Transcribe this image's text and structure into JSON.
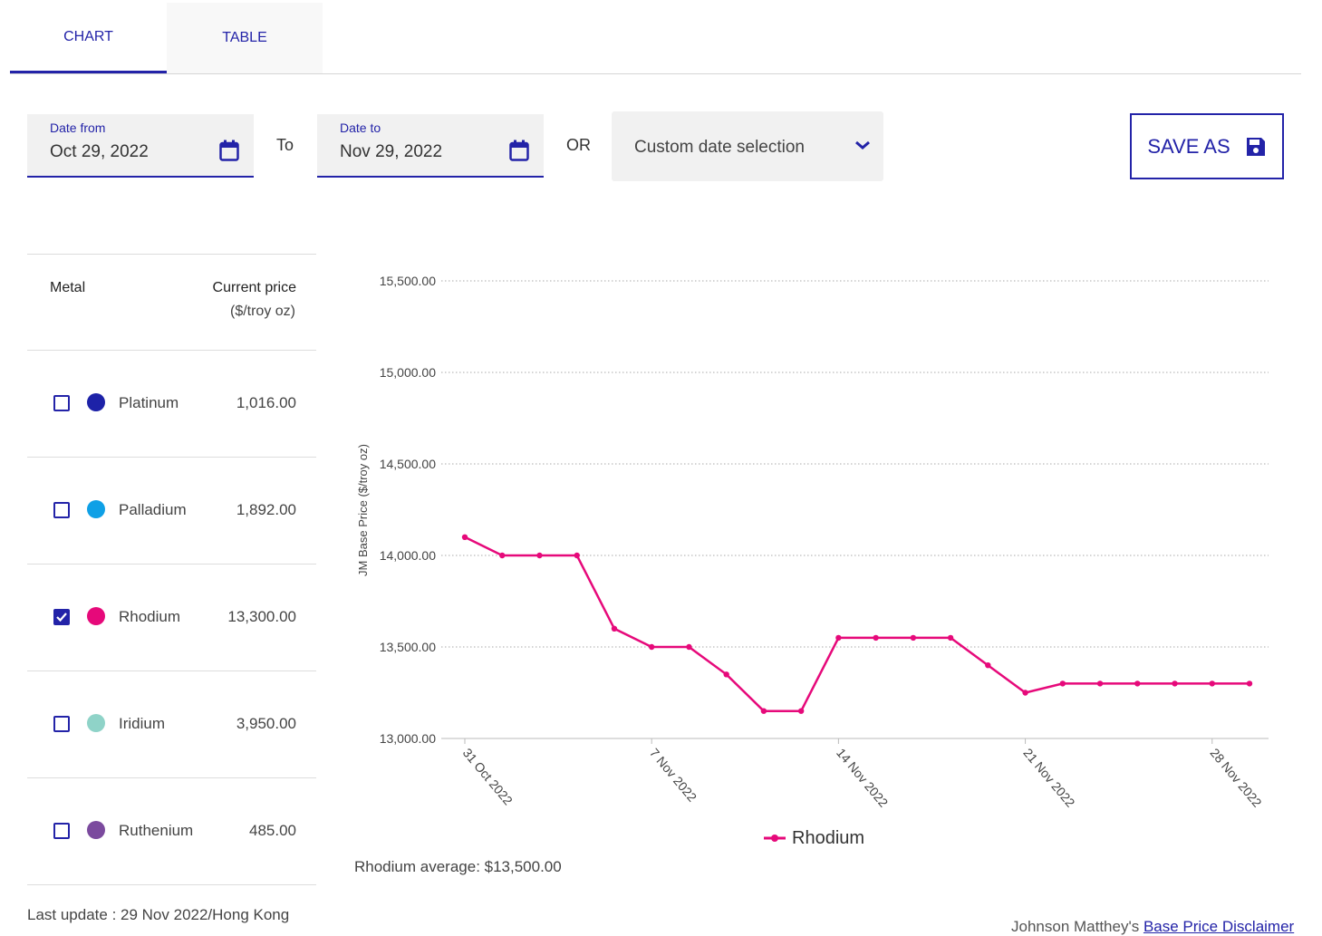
{
  "tabs": [
    {
      "label": "CHART",
      "active": true
    },
    {
      "label": "TABLE",
      "active": false
    }
  ],
  "date_from": {
    "label": "Date from",
    "value": "Oct 29, 2022"
  },
  "to_label": "To",
  "date_to": {
    "label": "Date to",
    "value": "Nov 29, 2022"
  },
  "or_label": "OR",
  "custom_select": {
    "value": "Custom date selection"
  },
  "save_as": {
    "label": "SAVE AS",
    "icon": "floppy-disk-icon"
  },
  "table": {
    "header_metal": "Metal",
    "header_price": "Current price",
    "header_unit": "($/troy oz)",
    "rows": [
      {
        "name": "Platinum",
        "price": "1,016.00",
        "color": "#1d22a8",
        "checked": false
      },
      {
        "name": "Palladium",
        "price": "1,892.00",
        "color": "#0fa0e6",
        "checked": false
      },
      {
        "name": "Rhodium",
        "price": "13,300.00",
        "color": "#e6097a",
        "checked": true
      },
      {
        "name": "Iridium",
        "price": "3,950.00",
        "color": "#8fd3c8",
        "checked": false
      },
      {
        "name": "Ruthenium",
        "price": "485.00",
        "color": "#7b4a9e",
        "checked": false
      }
    ]
  },
  "last_update": "Last update : 29 Nov 2022/Hong Kong",
  "average": "Rhodium average: $13,500.00",
  "disclaimer": {
    "prefix": "Johnson Matthey's ",
    "link": "Base Price Disclaimer"
  },
  "chart_data": {
    "type": "line",
    "ylabel": "JM Base Price ($/troy oz)",
    "xlabel": "",
    "ylim": [
      13000,
      15500
    ],
    "yticks": [
      "13,000.00",
      "13,500.00",
      "14,000.00",
      "14,500.00",
      "15,000.00",
      "15,500.00"
    ],
    "ytick_values": [
      13000,
      13500,
      14000,
      14500,
      15000,
      15500
    ],
    "xtick_labels": [
      "31 Oct 2022",
      "7 Nov 2022",
      "14 Nov 2022",
      "21 Nov 2022",
      "28 Nov 2022"
    ],
    "grid": true,
    "legend_position": "bottom",
    "x": [
      "2022-10-31",
      "2022-11-01",
      "2022-11-02",
      "2022-11-03",
      "2022-11-04",
      "2022-11-07",
      "2022-11-08",
      "2022-11-09",
      "2022-11-10",
      "2022-11-11",
      "2022-11-14",
      "2022-11-15",
      "2022-11-16",
      "2022-11-17",
      "2022-11-18",
      "2022-11-21",
      "2022-11-22",
      "2022-11-23",
      "2022-11-24",
      "2022-11-25",
      "2022-11-28",
      "2022-11-29"
    ],
    "series": [
      {
        "name": "Rhodium",
        "color": "#e6097a",
        "values": [
          14100,
          14000,
          14000,
          14000,
          13600,
          13500,
          13500,
          13350,
          13150,
          13150,
          13550,
          13550,
          13550,
          13550,
          13400,
          13250,
          13300,
          13300,
          13300,
          13300,
          13300,
          13300
        ]
      }
    ]
  }
}
